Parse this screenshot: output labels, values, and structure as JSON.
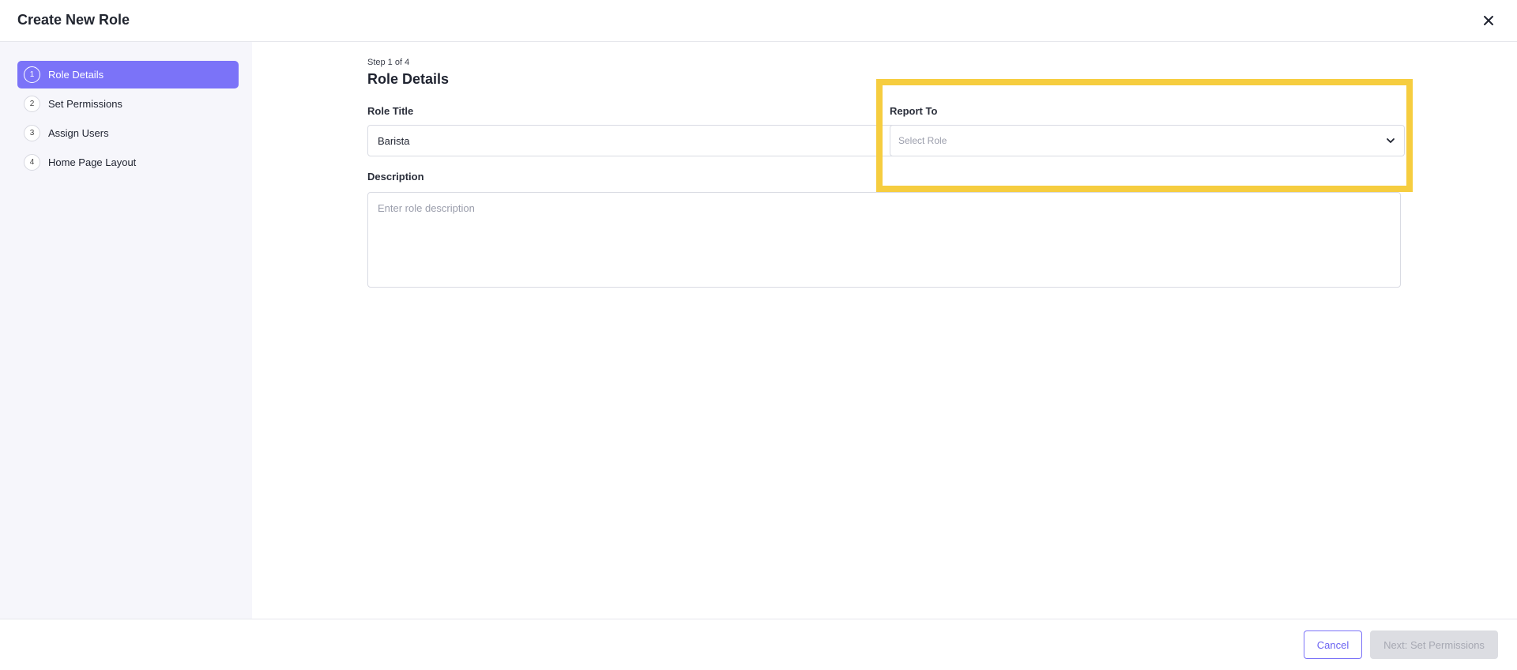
{
  "header": {
    "title": "Create New Role",
    "close_icon": "close-icon"
  },
  "sidebar": {
    "steps": [
      {
        "number": "1",
        "label": "Role Details",
        "active": true
      },
      {
        "number": "2",
        "label": "Set Permissions",
        "active": false
      },
      {
        "number": "3",
        "label": "Assign Users",
        "active": false
      },
      {
        "number": "4",
        "label": "Home Page Layout",
        "active": false
      }
    ]
  },
  "main": {
    "step_counter": "Step 1 of 4",
    "section_title": "Role Details",
    "role_title": {
      "label": "Role Title",
      "value": "Barista"
    },
    "report_to": {
      "label": "Report To",
      "placeholder": "Select Role",
      "icon": "chevron-down-icon"
    },
    "description": {
      "label": "Description",
      "placeholder": "Enter role description",
      "value": ""
    }
  },
  "footer": {
    "cancel_label": "Cancel",
    "next_label": "Next: Set Permissions"
  },
  "colors": {
    "accent": "#7b73f8",
    "highlight": "#f6cd3f",
    "sidebar_bg": "#f6f6fb",
    "disabled_bg": "#dcdde2"
  }
}
